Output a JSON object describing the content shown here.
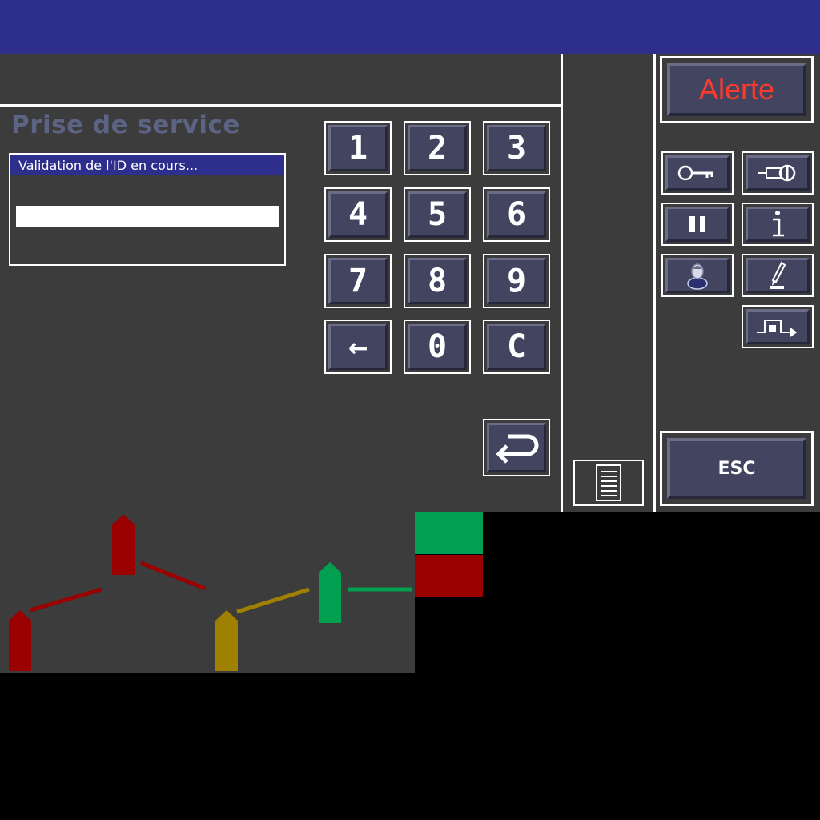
{
  "screen": {
    "title": "Prise de service",
    "status_message": "Validation de l'ID en cours...",
    "id_input_value": ""
  },
  "keypad": {
    "keys": [
      "1",
      "2",
      "3",
      "4",
      "5",
      "6",
      "7",
      "8",
      "9",
      "←",
      "0",
      "C"
    ],
    "enter_icon": "return-arrow-icon"
  },
  "side_panel": {
    "alert_label": "Alerte",
    "esc_label": "ESC",
    "icons": [
      "key-icon",
      "microphone-icon",
      "pause-icon",
      "info-icon",
      "operator-icon",
      "pen-icon",
      "signal-pulse-icon",
      "document-icon"
    ]
  },
  "colors": {
    "header": "#2e2e8c",
    "background": "#3c3c3c",
    "alert_text": "#ff3a2a",
    "signal_red": "#9b0000",
    "signal_yellow": "#a08000",
    "signal_green": "#00a050"
  }
}
